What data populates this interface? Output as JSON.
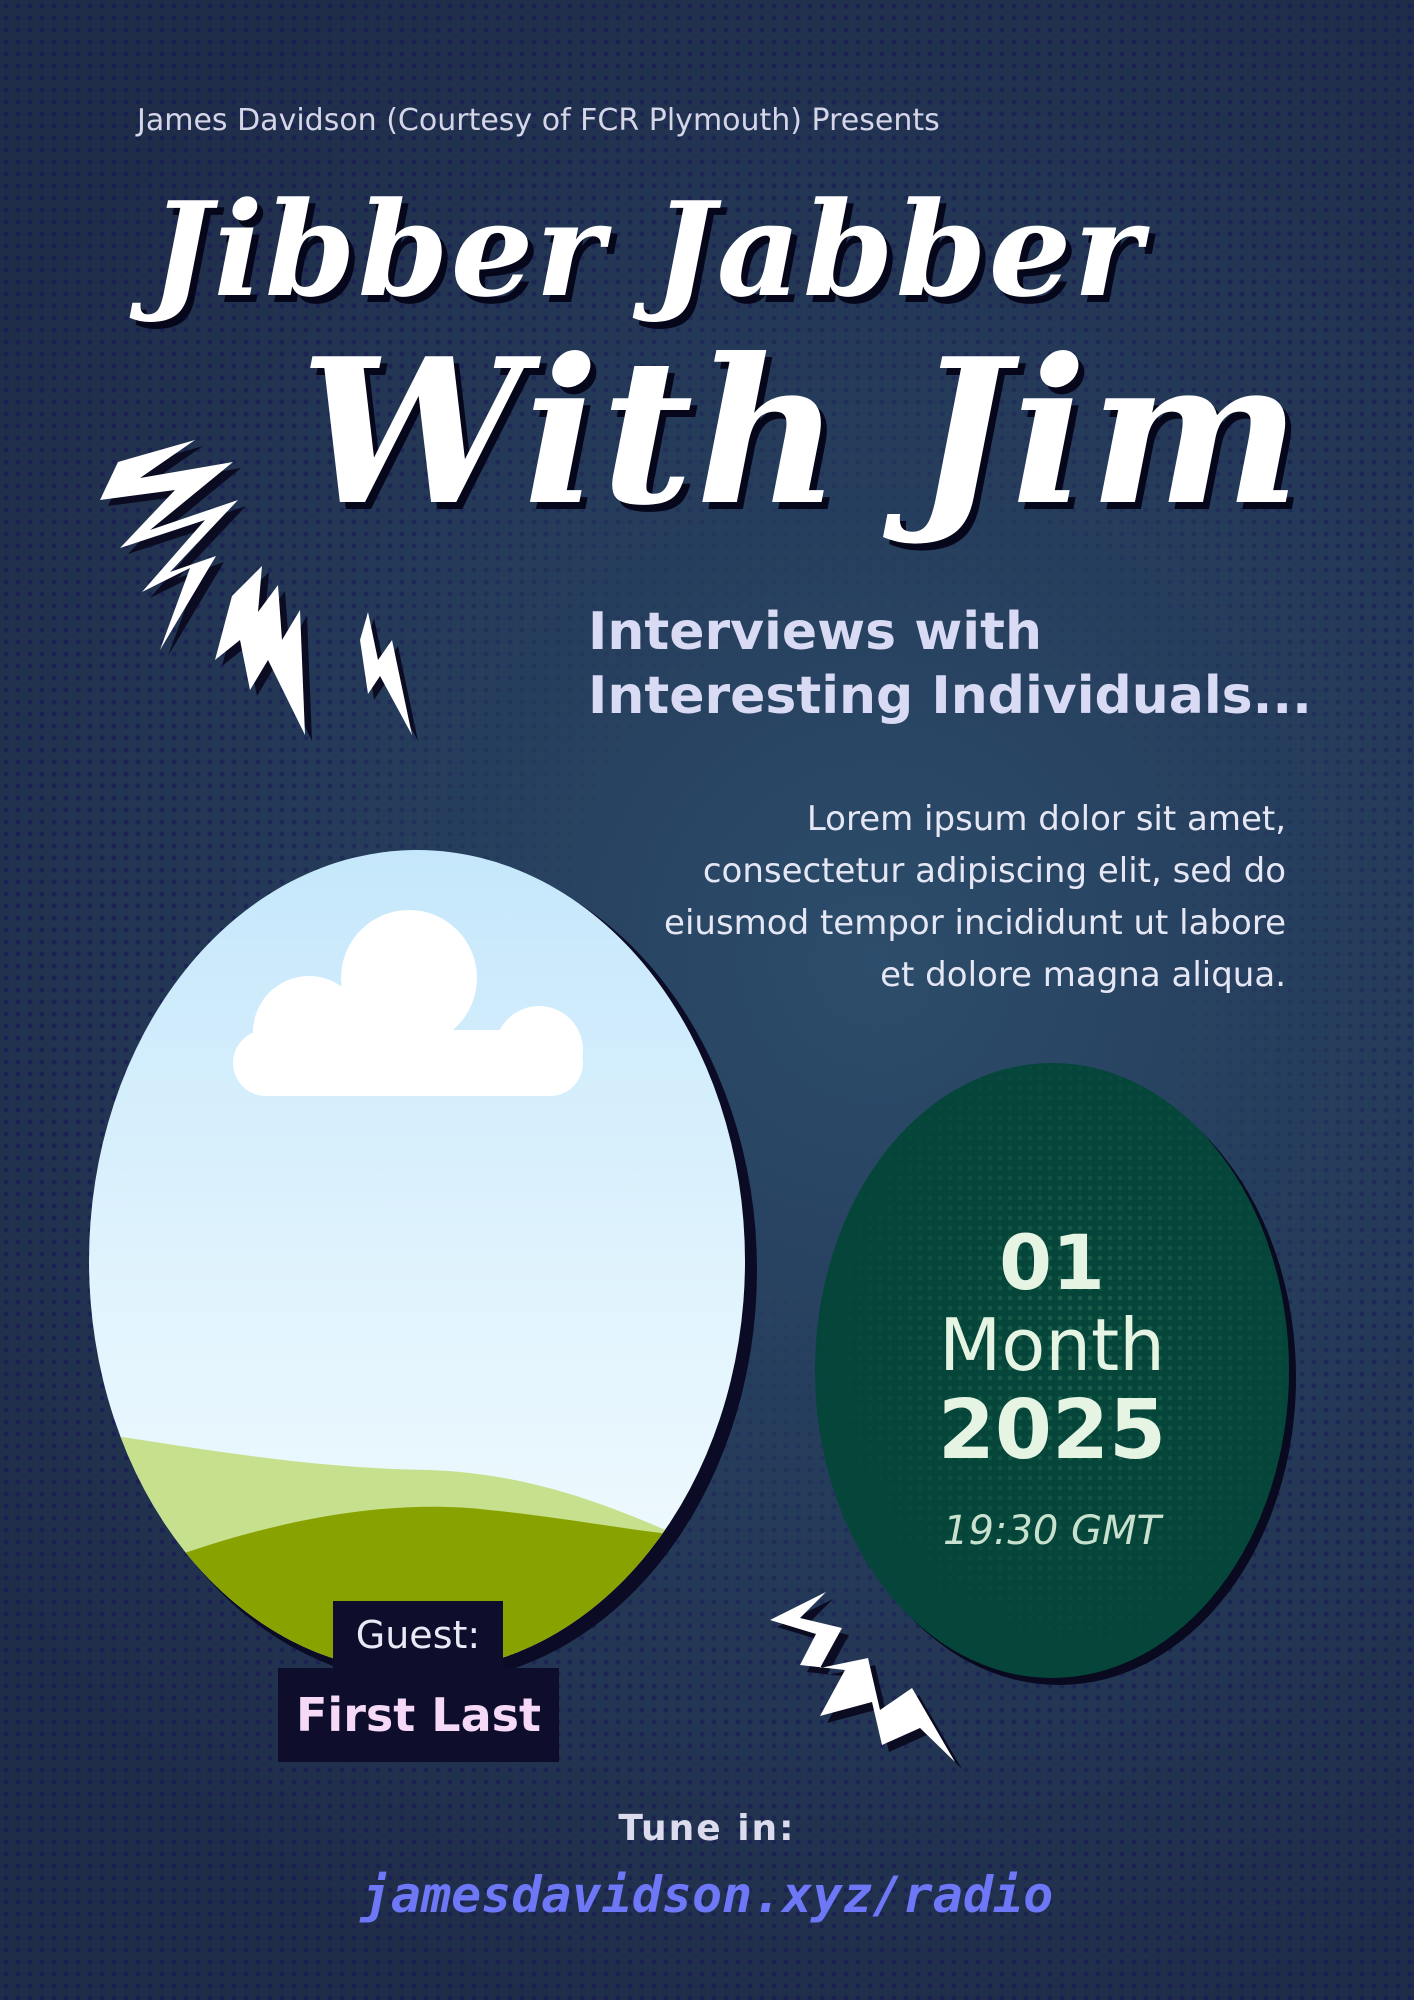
{
  "presenter": "James Davidson (Courtesy of FCR Plymouth) Presents",
  "title": {
    "line1": "Jibber Jabber",
    "line2": "With Jim"
  },
  "tagline": {
    "line1": "Interviews with",
    "line2": "Interesting Individuals..."
  },
  "description": "Lorem ipsum dolor sit amet, consectetur adipiscing elit, sed do eiusmod tempor incididunt ut labore et dolore magna aliqua.",
  "guest": {
    "label": "Guest:",
    "name": "First Last"
  },
  "date": {
    "day": "01",
    "month": "Month",
    "year": "2025",
    "time": "19:30 GMT"
  },
  "tune_in": {
    "label": "Tune in:",
    "url": "jamesdavidson.xyz/radio"
  },
  "colors": {
    "background": "#263d5c",
    "title": "#ffffff",
    "tagline": "#d9daf3",
    "date_oval": "#05453a",
    "url": "#6e78f7",
    "label_box": "#0e0e2c"
  },
  "icons": [
    "lightning-bolt-icon",
    "zigzag-bolt-icon",
    "cloud-icon",
    "hills-icon"
  ]
}
